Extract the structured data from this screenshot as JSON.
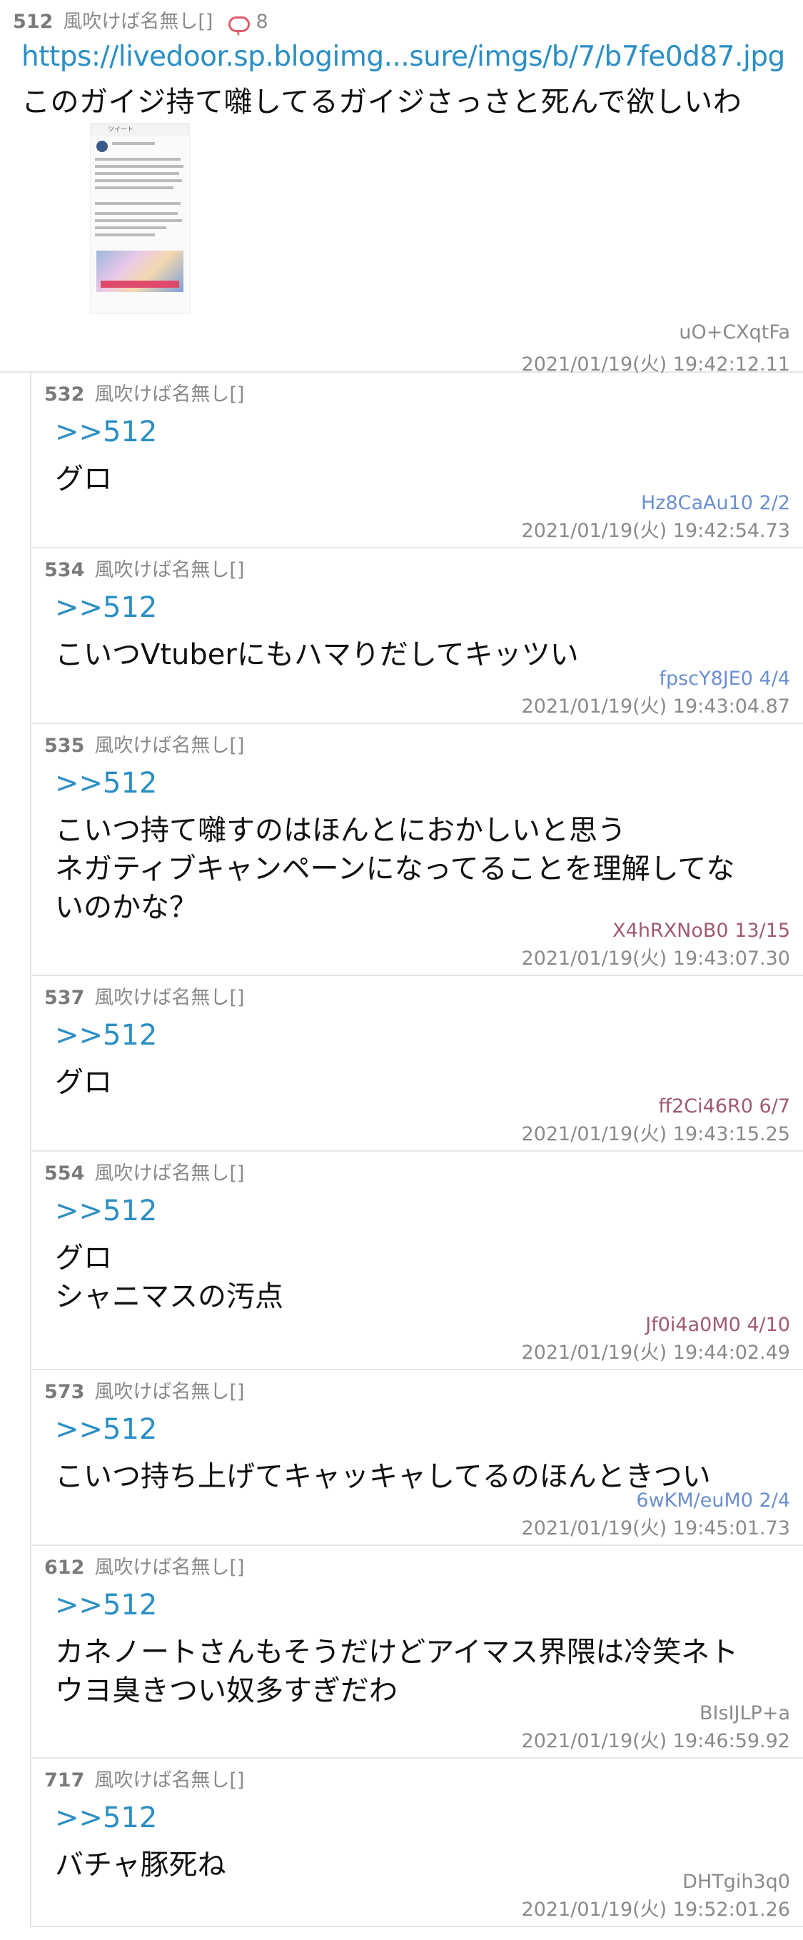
{
  "op": {
    "num": "512",
    "name": "風吹けば名無し[]",
    "comments": "8",
    "link": "https://livedoor.sp.blogimg...sure/imgs/b/7/b7fe0d87.jpg",
    "text": "このガイジ持て囃してるガイジさっさと死んで欲しいわ",
    "thumb_header": "ツイート",
    "id": "uO+CXqtFa",
    "date": "2021/01/19(火) 19:42:12.11"
  },
  "replies": [
    {
      "num": "532",
      "name": "風吹けば名無し[]",
      "anchor": ">>512",
      "body": "グロ",
      "id": "Hz8CaAu10 2/2",
      "id_color": "#6b8fd0",
      "date": "2021/01/19(火) 19:42:54.73"
    },
    {
      "num": "534",
      "name": "風吹けば名無し[]",
      "anchor": ">>512",
      "body": "こいつVtuberにもハマりだしてキッツい",
      "id": "fpscY8JE0 4/4",
      "id_color": "#6b8fd0",
      "date": "2021/01/19(火) 19:43:04.87"
    },
    {
      "num": "535",
      "name": "風吹けば名無し[]",
      "anchor": ">>512",
      "body": "こいつ持て囃すのはほんとにおかしいと思う\nネガティブキャンペーンになってることを理解してな\nいのかな？",
      "id": "X4hRXNoB0 13/15",
      "id_color": "#a05a6e",
      "date": "2021/01/19(火) 19:43:07.30"
    },
    {
      "num": "537",
      "name": "風吹けば名無し[]",
      "anchor": ">>512",
      "body": "グロ",
      "id": "ff2Ci46R0 6/7",
      "id_color": "#a05a6e",
      "date": "2021/01/19(火) 19:43:15.25"
    },
    {
      "num": "554",
      "name": "風吹けば名無し[]",
      "anchor": ">>512",
      "body": "グロ\nシャニマスの汚点",
      "id": "Jf0i4a0M0 4/10",
      "id_color": "#a05a6e",
      "date": "2021/01/19(火) 19:44:02.49"
    },
    {
      "num": "573",
      "name": "風吹けば名無し[]",
      "anchor": ">>512",
      "body": "こいつ持ち上げてキャッキャしてるのほんときつい",
      "id": "6wKM/euM0 2/4",
      "id_color": "#6b8fd0",
      "date": "2021/01/19(火) 19:45:01.73"
    },
    {
      "num": "612",
      "name": "風吹けば名無し[]",
      "anchor": ">>512",
      "body": "カネノートさんもそうだけどアイマス界隈は冷笑ネト\nウヨ臭きつい奴多すぎだわ",
      "id": "BIsIJLP+a",
      "id_color": "#8a8a8a",
      "date": "2021/01/19(火) 19:46:59.92"
    },
    {
      "num": "717",
      "name": "風吹けば名無し[]",
      "anchor": ">>512",
      "body": "バチャ豚死ね",
      "id": "DHTgih3q0",
      "id_color": "#8a8a8a",
      "date": "2021/01/19(火) 19:52:01.26"
    }
  ]
}
